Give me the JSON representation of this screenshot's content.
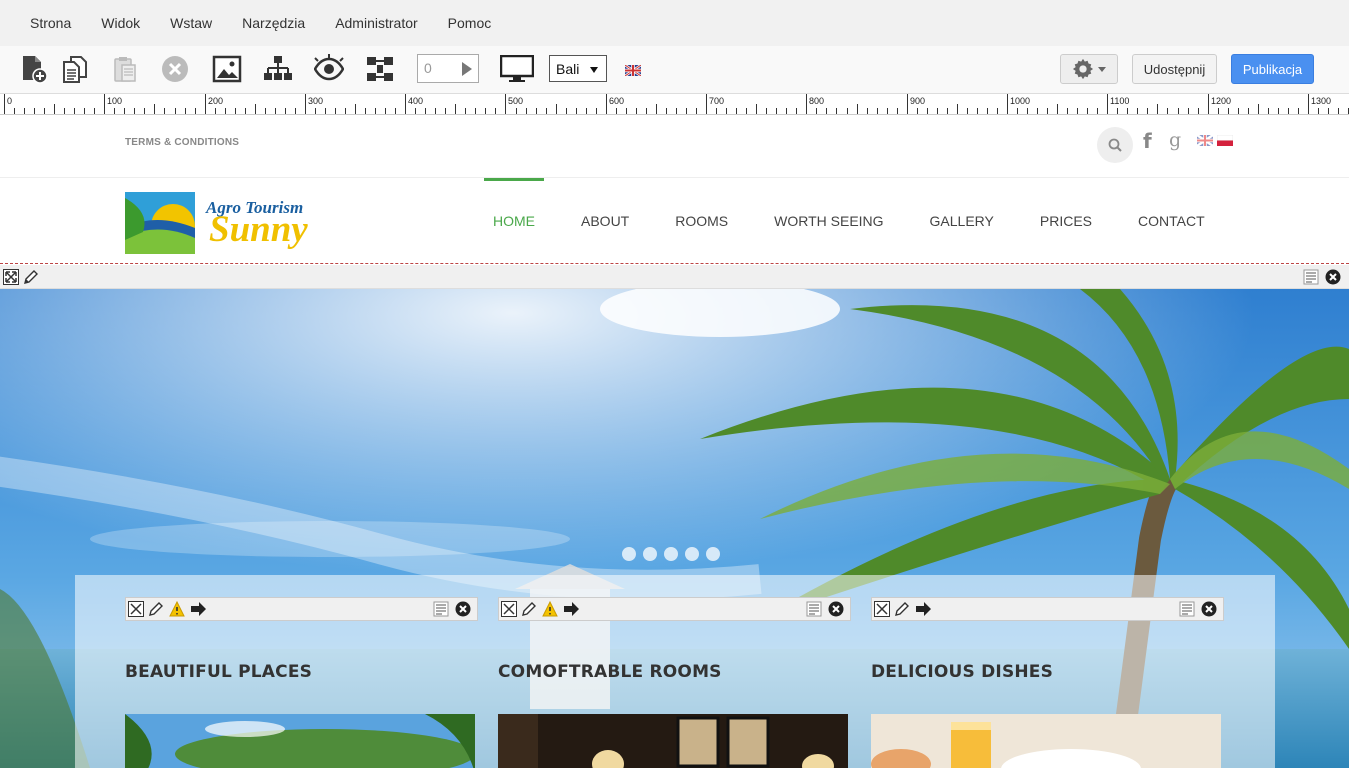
{
  "menu": [
    "Strona",
    "Widok",
    "Wstaw",
    "Narzędzia",
    "Administrator",
    "Pomoc"
  ],
  "toolbar": {
    "page_number": "0",
    "theme_selected": "Bali",
    "share_label": "Udostępnij",
    "publish_label": "Publikacja",
    "icons": [
      "add-page-icon",
      "copy-page-icon",
      "paste-icon",
      "delete-icon",
      "image-icon",
      "sitemap-icon",
      "preview-eye-icon",
      "structure-icon",
      "desktop-view-icon",
      "uk-flag-icon",
      "gear-icon"
    ],
    "accent": "#4a90f0"
  },
  "ruler": {
    "labels": [
      "0",
      "100",
      "200",
      "300",
      "400",
      "500",
      "600",
      "700",
      "800",
      "900",
      "1000",
      "1100",
      "1200",
      "1300"
    ]
  },
  "site": {
    "terms": "TERMS & CONDITIONS",
    "logo_line1": "Agro Tourism",
    "logo_line2": "Sunny",
    "nav": [
      {
        "label": "HOME",
        "active": true
      },
      {
        "label": "ABOUT",
        "active": false
      },
      {
        "label": "ROOMS",
        "active": false
      },
      {
        "label": "WORTH SEEING",
        "active": false
      },
      {
        "label": "GALLERY",
        "active": false
      },
      {
        "label": "PRICES",
        "active": false
      },
      {
        "label": "CONTACT",
        "active": false
      }
    ],
    "nav_active_color": "#4aa84a",
    "columns": [
      {
        "title": "BEAUTIFUL PLACES",
        "has_warning": true
      },
      {
        "title": "COMOFTRABLE ROOMS",
        "has_warning": true
      },
      {
        "title": "DELICIOUS DISHES",
        "has_warning": false
      }
    ]
  }
}
